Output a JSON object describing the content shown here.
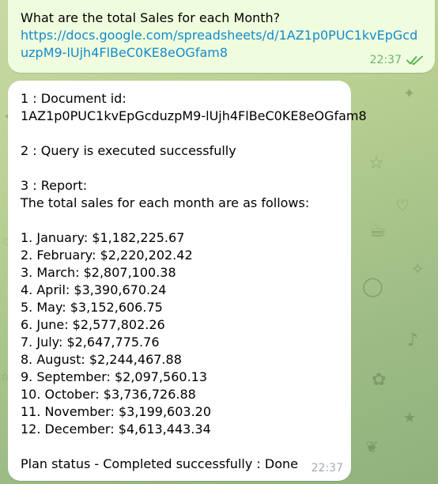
{
  "colors": {
    "outgoing_bubble": "#effdde",
    "incoming_bubble": "#ffffff",
    "link": "#168acd",
    "outgoing_time": "#6cb27a",
    "incoming_time": "#a2acb4",
    "chat_background": "#b7cf91"
  },
  "outgoing": {
    "text": "What are the total Sales for each Month?",
    "link": "https://docs.google.com/spreadsheets/d/1AZ1p0PUC1kvEpGcduzpM9-lUjh4FlBeC0KE8eOGfam8",
    "time": "22:37",
    "status_icon": "double-check-read-icon"
  },
  "incoming": {
    "doc_label": "1 : Document id:",
    "doc_id": "1AZ1p0PUC1kvEpGcduzpM9-lUjh4FlBeC0KE8eOGfam8",
    "query_status": "2 : Query is executed successfully",
    "report_label": "3 : Report:",
    "report_intro": "The total sales for each month are as follows:",
    "months": [
      "1. January: $1,182,225.67",
      "2. February: $2,220,202.42",
      "3. March: $2,807,100.38",
      "4. April: $3,390,670.24",
      "5. May: $3,152,606.75",
      "6. June: $2,577,802.26",
      "7. July: $2,647,775.76",
      "8. August: $2,244,467.88",
      "9. September: $2,097,560.13",
      "10. October: $3,736,726.88",
      "11. November: $3,199,603.20",
      "12. December: $4,613,443.34"
    ],
    "plan_status": "Plan status - Completed successfully : Done",
    "time": "22:37"
  }
}
